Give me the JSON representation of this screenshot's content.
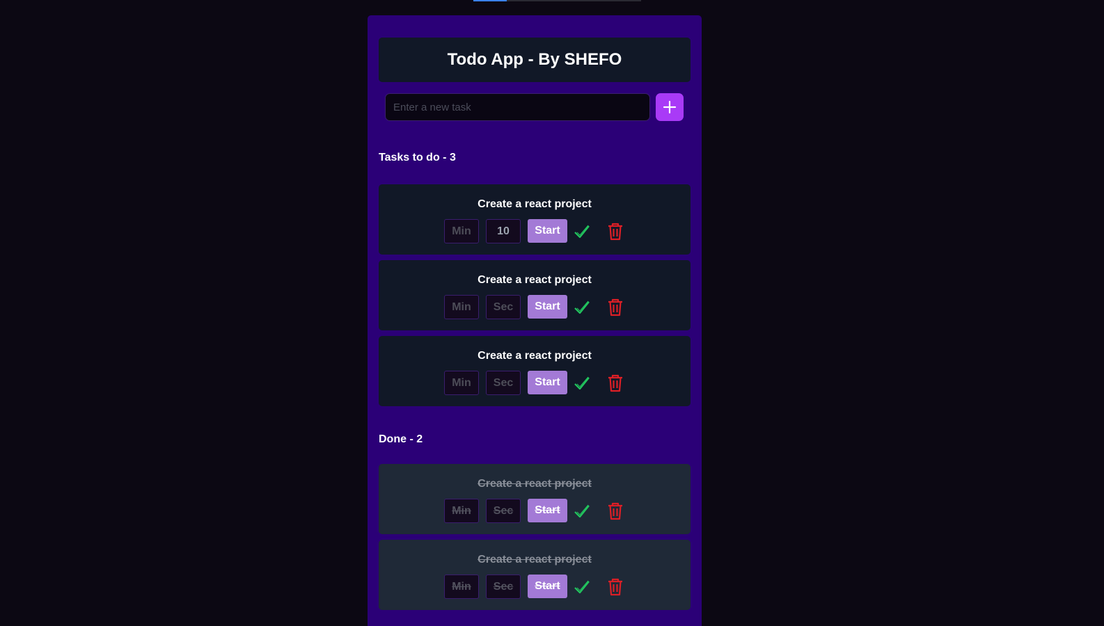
{
  "app": {
    "title": "Todo App - By SHEFO"
  },
  "new_task": {
    "value": "",
    "placeholder": "Enter a new task",
    "add_icon": "plus-icon"
  },
  "todo_section": {
    "title": "Tasks to do - 3",
    "tasks": [
      {
        "name": "Create a react project",
        "min": "Min",
        "sec": "10",
        "start_label": "Start"
      },
      {
        "name": "Create a react project",
        "min": "Min",
        "sec": "Sec",
        "start_label": "Start"
      },
      {
        "name": "Create a react project",
        "min": "Min",
        "sec": "Sec",
        "start_label": "Start"
      }
    ]
  },
  "done_section": {
    "title": "Done - 2",
    "tasks": [
      {
        "name": "Create a react project",
        "min": "Min",
        "sec": "Sec",
        "start_label": "Start"
      },
      {
        "name": "Create a react project",
        "min": "Min",
        "sec": "Sec",
        "start_label": "Start"
      }
    ]
  },
  "icons": {
    "complete": "check-icon",
    "delete": "trash-icon"
  },
  "colors": {
    "panel_bg": "#2b0077",
    "card_bg": "#111827",
    "done_card_bg": "#1f2937",
    "accent": "#a93af7",
    "start_button": "#a37ad6",
    "check": "#22c55e",
    "trash": "#dc1f26"
  }
}
